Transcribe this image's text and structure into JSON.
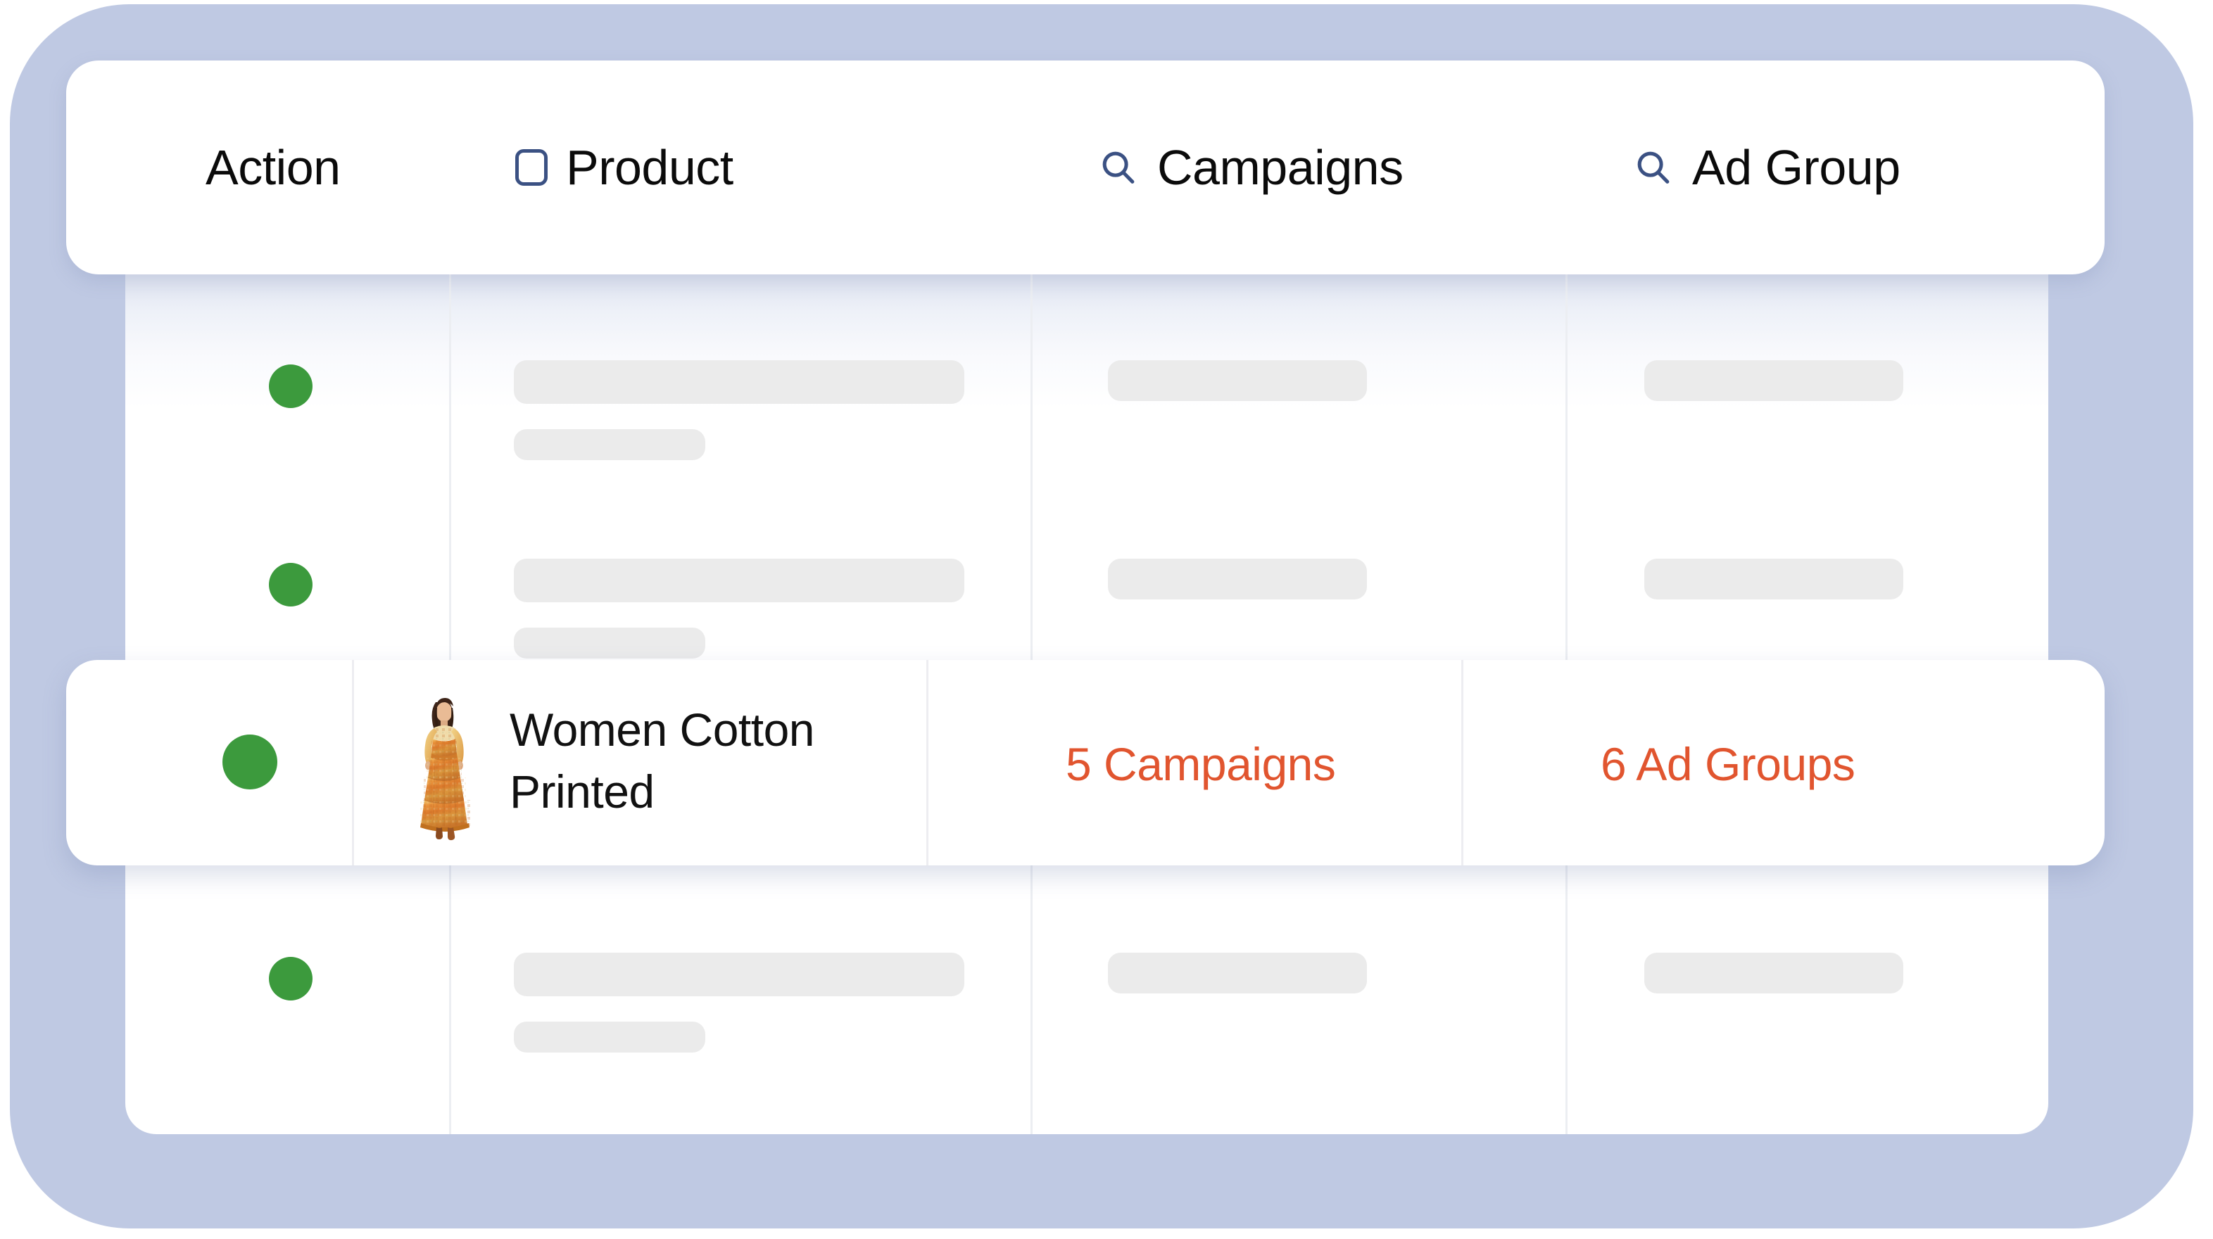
{
  "theme": {
    "frame_bg": "#BFC9E3",
    "card_bg": "#FFFFFF",
    "accent_orange": "#E1552F",
    "status_green": "#3C9A3D",
    "icon_navy": "#3B5183",
    "skeleton_grey": "#EBEBEB",
    "divider_grey": "#ECEEF2"
  },
  "table": {
    "columns": [
      {
        "key": "action",
        "label": "Action",
        "icon": null
      },
      {
        "key": "product",
        "label": "Product",
        "icon": "checkbox-unchecked-icon"
      },
      {
        "key": "campaigns",
        "label": "Campaigns",
        "icon": "search-icon"
      },
      {
        "key": "ad_group",
        "label": "Ad Group",
        "icon": "search-icon"
      }
    ],
    "rows": [
      {
        "type": "placeholder",
        "status": "active",
        "status_color": "#3C9A3D"
      },
      {
        "type": "placeholder",
        "status": "active",
        "status_color": "#3C9A3D"
      },
      {
        "type": "data",
        "highlighted": true,
        "status": "active",
        "status_color": "#3C9A3D",
        "product_name": "Women Cotton Printed",
        "product_image_alt": "woman-in-orange-printed-maxi-dress",
        "campaigns": "5 Campaigns",
        "ad_group": "6 Ad Groups"
      },
      {
        "type": "placeholder",
        "status": "active",
        "status_color": "#3C9A3D"
      }
    ]
  }
}
